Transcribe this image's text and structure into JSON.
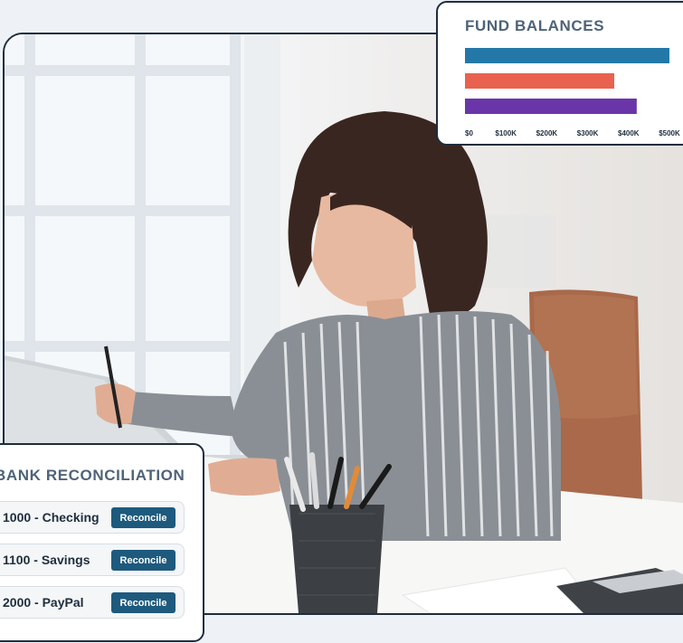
{
  "fund_balances": {
    "title": "FUND BALANCES",
    "chart_data": {
      "type": "bar",
      "orientation": "horizontal",
      "title": "FUND BALANCES",
      "categories": [
        "",
        "",
        ""
      ],
      "values": [
        500000,
        365000,
        420000
      ],
      "colors": [
        "#2378a8",
        "#e8624f",
        "#6a35a8"
      ],
      "xlim": [
        0,
        500000
      ],
      "xticks": [
        "$0",
        "$100K",
        "$200K",
        "$300K",
        "$400K",
        "$500K"
      ],
      "grid": false
    }
  },
  "bank_reconciliation": {
    "title": "BANK RECONCILIATION",
    "rows": [
      {
        "account": "1000 - Checking",
        "button": "Reconcile"
      },
      {
        "account": "1100 - Savings",
        "button": "Reconcile"
      },
      {
        "account": "2000 - PayPal",
        "button": "Reconcile"
      }
    ]
  },
  "colors": {
    "accent": "#1e5a7d",
    "frame": "#1f2d3d",
    "title": "#4e6379"
  }
}
